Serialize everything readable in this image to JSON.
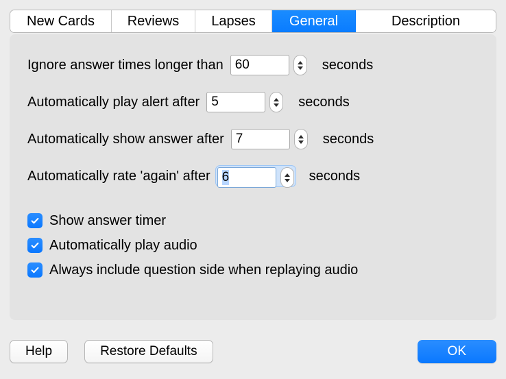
{
  "tabs": [
    {
      "label": "New Cards",
      "selected": false
    },
    {
      "label": "Reviews",
      "selected": false
    },
    {
      "label": "Lapses",
      "selected": false
    },
    {
      "label": "General",
      "selected": true
    },
    {
      "label": "Description",
      "selected": false
    }
  ],
  "settings": {
    "ignore_times": {
      "label": "Ignore answer times longer than",
      "value": "60",
      "unit": "seconds"
    },
    "play_alert": {
      "label": "Automatically play alert after",
      "value": "5",
      "unit": "seconds"
    },
    "show_answer": {
      "label": "Automatically show answer after",
      "value": "7",
      "unit": "seconds"
    },
    "rate_again": {
      "label": "Automatically rate 'again' after",
      "value": "6",
      "unit": "seconds",
      "focused": true
    }
  },
  "checkboxes": {
    "show_timer": {
      "label": "Show answer timer",
      "checked": true
    },
    "auto_audio": {
      "label": "Automatically play audio",
      "checked": true
    },
    "include_question": {
      "label": "Always include question side when replaying audio",
      "checked": true
    }
  },
  "buttons": {
    "help": "Help",
    "restore": "Restore Defaults",
    "ok": "OK"
  }
}
